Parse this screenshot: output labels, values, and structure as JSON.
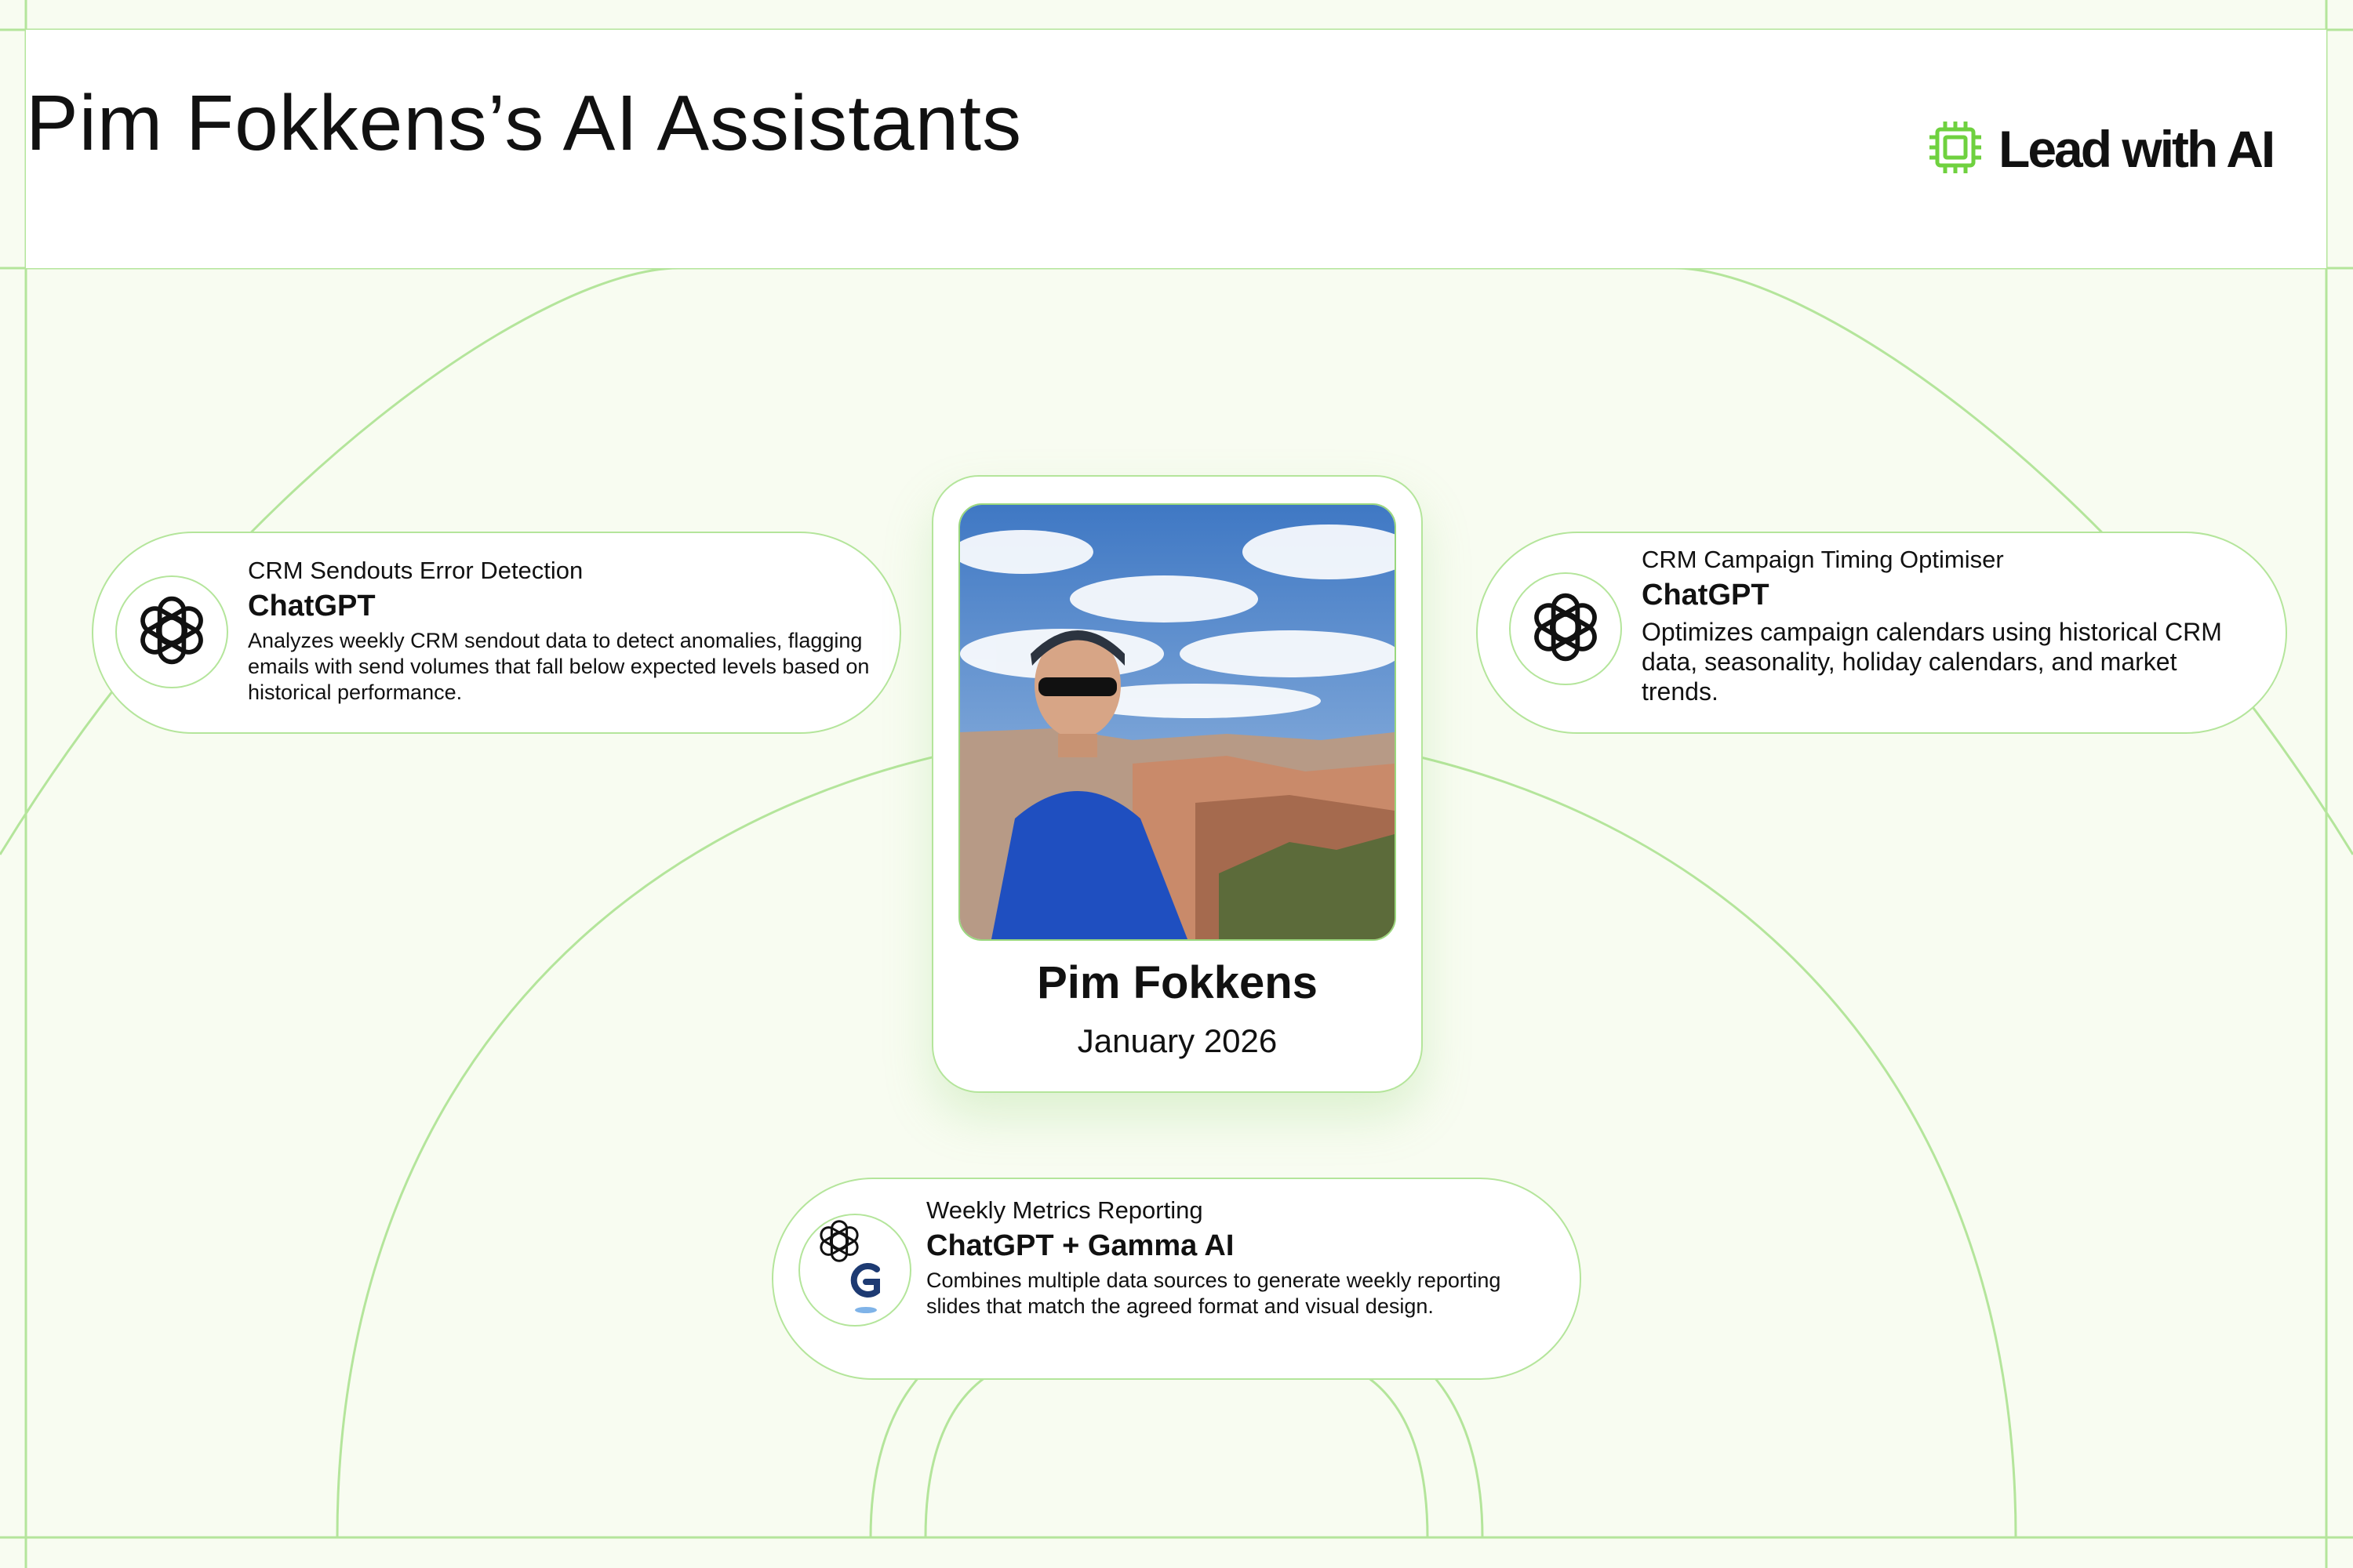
{
  "header": {
    "title": "Pim Fokkens’s AI Assistants",
    "logo_text": "Lead with AI",
    "logo_icon": "chip-icon",
    "accent_color": "#6fd13f"
  },
  "profile": {
    "name": "Pim Fokkens",
    "date": "January 2026",
    "photo_icon": "profile-photo"
  },
  "assistants": [
    {
      "subtitle": "CRM Sendouts Error Detection",
      "tool": "ChatGPT",
      "icon": "openai-icon",
      "description": "Analyzes weekly CRM sendout data to detect anomalies, flagging emails with send volumes that fall below expected levels based on historical performance."
    },
    {
      "subtitle": "CRM Campaign Timing Optimiser",
      "tool": "ChatGPT",
      "icon": "openai-icon",
      "description": "Optimizes campaign calendars using historical CRM data, seasonality, holiday calendars, and market trends."
    },
    {
      "subtitle": "Weekly Metrics Reporting",
      "tool": "ChatGPT + Gamma AI",
      "icon": "openai-gamma-icon",
      "description": "Combines multiple data sources to generate weekly reporting slides that match the agreed format and visual design."
    }
  ],
  "colors": {
    "background": "#f8fcf1",
    "line": "#b4e59b",
    "card_border": "#b4e59b",
    "text": "#111111"
  }
}
